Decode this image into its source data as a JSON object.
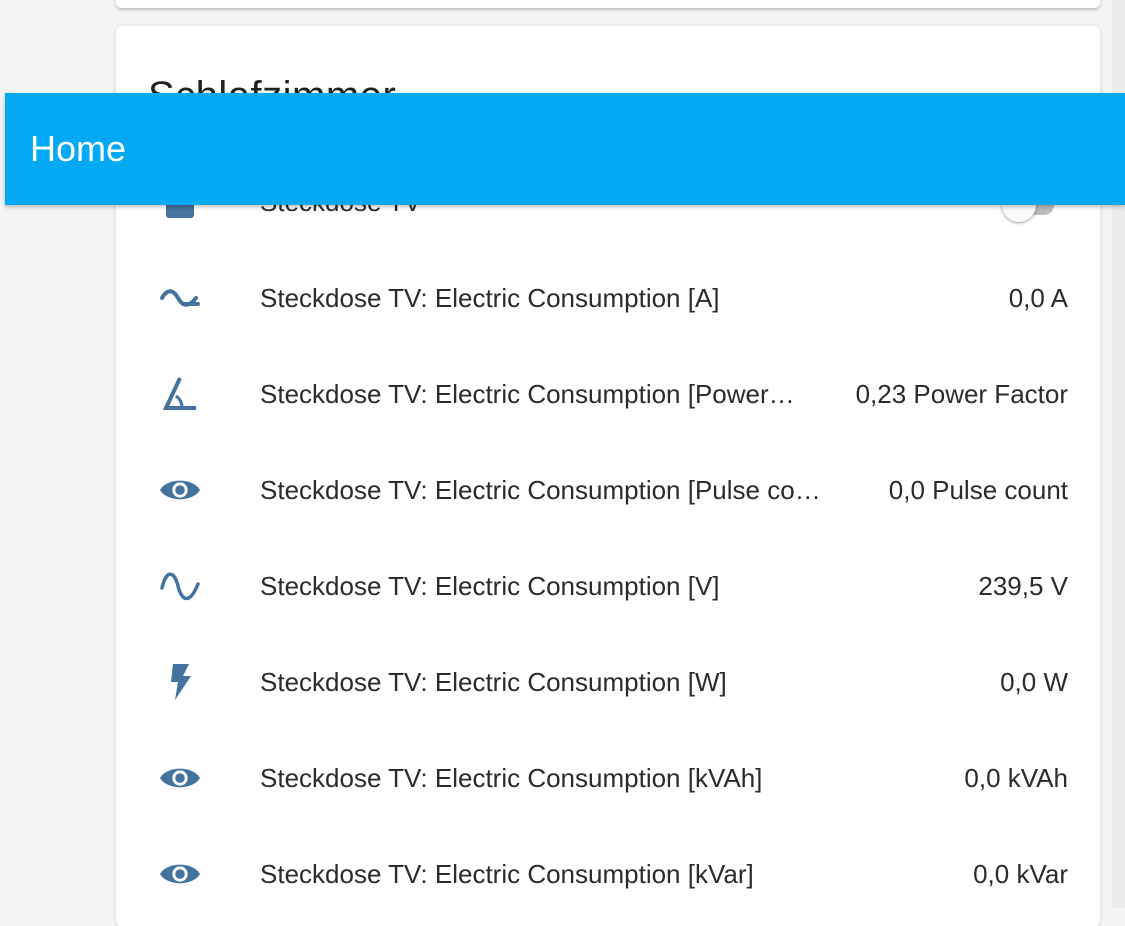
{
  "app": {
    "title": "Home"
  },
  "colors": {
    "header": "#03a9f4",
    "icon": "#44739e",
    "background": "#f4f4f4"
  },
  "card": {
    "title": "Schlafzimmer",
    "switch_row": {
      "name": "Steckdose TV",
      "icon": "power-socket-icon",
      "state": "off"
    },
    "rows": [
      {
        "name": "Steckdose TV: Electric Consumption [A]",
        "value": "0,0 A",
        "icon": "current-ac-icon"
      },
      {
        "name": "Steckdose TV: Electric Consumption [Power…",
        "value": "0,23 Power Factor",
        "icon": "angle-acute-icon"
      },
      {
        "name": "Steckdose TV: Electric Consumption [Pulse co…",
        "value": "0,0 Pulse count",
        "icon": "eye-icon"
      },
      {
        "name": "Steckdose TV: Electric Consumption [V]",
        "value": "239,5 V",
        "icon": "sine-wave-icon"
      },
      {
        "name": "Steckdose TV: Electric Consumption [W]",
        "value": "0,0 W",
        "icon": "flash-icon"
      },
      {
        "name": "Steckdose TV: Electric Consumption [kVAh]",
        "value": "0,0 kVAh",
        "icon": "eye-icon"
      },
      {
        "name": "Steckdose TV: Electric Consumption [kVar]",
        "value": "0,0 kVar",
        "icon": "eye-icon"
      }
    ]
  }
}
